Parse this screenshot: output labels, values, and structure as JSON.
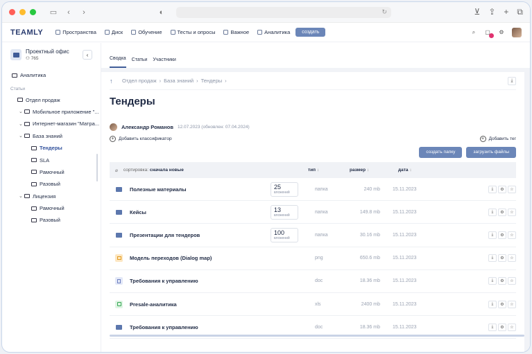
{
  "colors": {
    "accent": "#6b86b8",
    "brand": "#2b3d70",
    "dot_red": "#ff5f57",
    "dot_yellow": "#febc2e",
    "dot_green": "#28c840",
    "badge": "#e0336f"
  },
  "app": {
    "logo": "TEAMLY",
    "nav": [
      {
        "label": "Пространства",
        "icon": "spaces-icon"
      },
      {
        "label": "Диск",
        "icon": "disk-icon"
      },
      {
        "label": "Обучение",
        "icon": "education-icon"
      },
      {
        "label": "Тесты и опросы",
        "icon": "tests-icon"
      },
      {
        "label": "Важное",
        "icon": "bookmark-icon"
      },
      {
        "label": "Аналитика",
        "icon": "analytics-icon"
      }
    ],
    "create_label": "создать"
  },
  "sidebar": {
    "space_title": "Проектный офис",
    "space_count": "765",
    "analytics": "Аналитика",
    "caption": "Статьи",
    "items": [
      {
        "label": "Отдел продаж",
        "indent": 0,
        "chevron": false
      },
      {
        "label": "Мобильное приложение \"...",
        "indent": 1,
        "chevron": true
      },
      {
        "label": "Интернет-магазин \"Матра...",
        "indent": 1,
        "chevron": true
      },
      {
        "label": "База знаний",
        "indent": 1,
        "chevron": true
      },
      {
        "label": "Тендеры",
        "indent": 2,
        "chevron": false,
        "active": true
      },
      {
        "label": "SLA",
        "indent": 2,
        "chevron": false
      },
      {
        "label": "Рамочный",
        "indent": 2,
        "chevron": false
      },
      {
        "label": "Разовый",
        "indent": 2,
        "chevron": false
      },
      {
        "label": "Лицензия",
        "indent": 1,
        "chevron": true
      },
      {
        "label": "Рамочный",
        "indent": 2,
        "chevron": false
      },
      {
        "label": "Разовый",
        "indent": 2,
        "chevron": false
      }
    ]
  },
  "tabs": [
    "Сводка",
    "Статьи",
    "Участники"
  ],
  "breadcrumb": [
    "Отдел продаж",
    "База знаний",
    "Тендеры"
  ],
  "page": {
    "title": "Тендеры",
    "author": "Александр Романов",
    "dates": "12.07.2023 (обновлен: 07.04.2024)",
    "add_classifier": "Добавить классификатор",
    "add_tag": "Добавить тег",
    "create_folder": "создать папку",
    "upload_files": "загрузить файлы"
  },
  "table": {
    "sort_prefix": "сортировка:",
    "sort_value": "сначала новые",
    "col_type": "тип",
    "col_size": "размер",
    "col_date": "дата",
    "rows": [
      {
        "name": "Полезные материалы",
        "kind": "folder",
        "count": "25",
        "count_label": "вложений",
        "type": "папка",
        "size": "240 mb",
        "date": "15.11.2023"
      },
      {
        "name": "Кейсы",
        "kind": "folder",
        "count": "13",
        "count_label": "вложений",
        "type": "папка",
        "size": "149.8 mb",
        "date": "15.11.2023"
      },
      {
        "name": "Презентации для тендеров",
        "kind": "folder",
        "count": "100",
        "count_label": "вложений",
        "type": "папка",
        "size": "30.16 mb",
        "date": "15.11.2023"
      },
      {
        "name": "Модель переходов (Dialog map)",
        "kind": "png",
        "count": "",
        "count_label": "",
        "type": "png",
        "size": "650.6 mb",
        "date": "15.11.2023"
      },
      {
        "name": "Требования к управлению",
        "kind": "doc",
        "count": "",
        "count_label": "",
        "type": "doc",
        "size": "18.36 mb",
        "date": "15.11.2023"
      },
      {
        "name": "Presale-аналитика",
        "kind": "xls",
        "count": "",
        "count_label": "",
        "type": "xls",
        "size": "2400 mb",
        "date": "15.11.2023"
      },
      {
        "name": "Требования к управлению",
        "kind": "folder",
        "count": "",
        "count_label": "",
        "type": "doc",
        "size": "18.36 mb",
        "date": "15.11.2023"
      }
    ]
  }
}
